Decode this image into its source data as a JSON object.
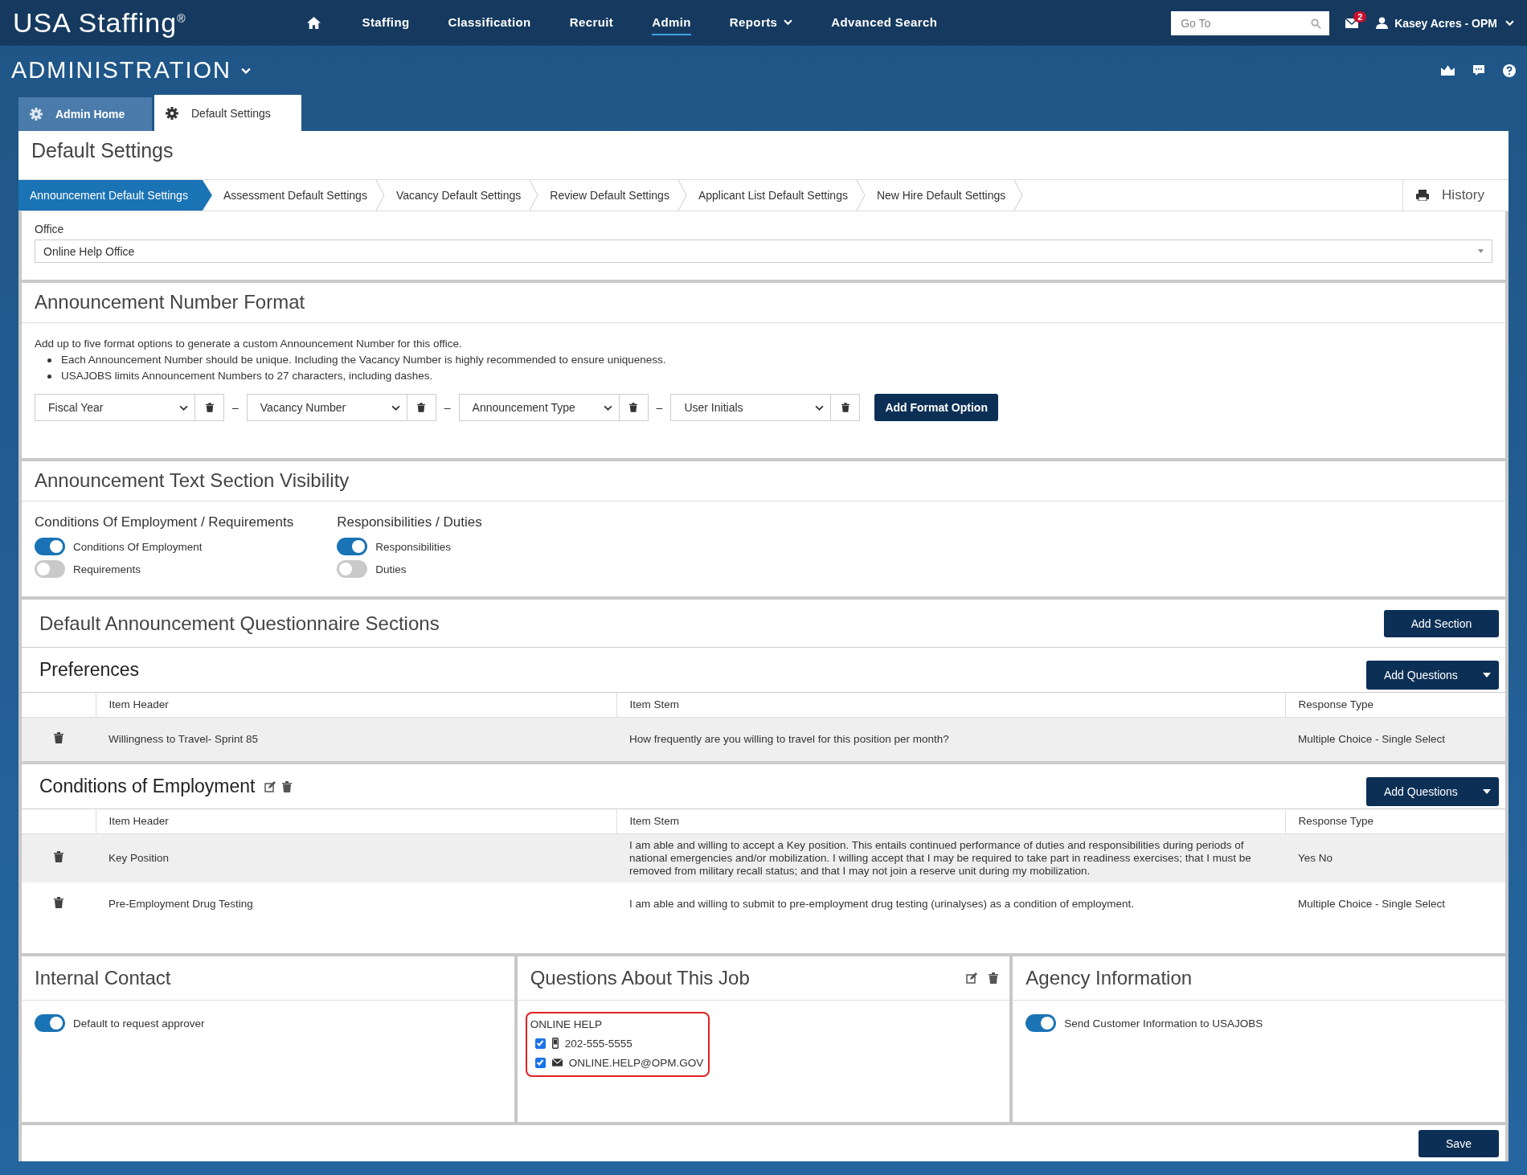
{
  "brand": {
    "name": "USA Staffing",
    "mark": "®"
  },
  "nav": [
    {
      "label": "Staffing",
      "selected": false,
      "dropdown": false
    },
    {
      "label": "Classification",
      "selected": false,
      "dropdown": false
    },
    {
      "label": "Recruit",
      "selected": false,
      "dropdown": false
    },
    {
      "label": "Admin",
      "selected": true,
      "dropdown": false
    },
    {
      "label": "Reports",
      "selected": false,
      "dropdown": true
    },
    {
      "label": "Advanced Search",
      "selected": false,
      "dropdown": false
    }
  ],
  "goto": {
    "placeholder": "Go To"
  },
  "mail_badge": "2",
  "user": "Kasey Acres - OPM",
  "app_title": "ADMINISTRATION",
  "page_tabs": [
    {
      "label": "Admin Home",
      "selected": false
    },
    {
      "label": "Default Settings",
      "selected": true
    }
  ],
  "page_title": "Default Settings",
  "steps": [
    {
      "label": "Announcement Default Settings",
      "selected": true
    },
    {
      "label": "Assessment Default Settings",
      "selected": false
    },
    {
      "label": "Vacancy Default Settings",
      "selected": false
    },
    {
      "label": "Review Default Settings",
      "selected": false
    },
    {
      "label": "Applicant List Default Settings",
      "selected": false
    },
    {
      "label": "New Hire Default Settings",
      "selected": false
    }
  ],
  "history": "History",
  "office": {
    "label": "Office",
    "value": "Online Help Office"
  },
  "number_format": {
    "title": "Announcement Number Format",
    "intro": "Add up to five format options to generate a custom Announcement Number for this office.",
    "bullets": [
      "Each Announcement Number should be unique. Including the Vacancy Number is highly recommended to ensure uniqueness.",
      "USAJOBS limits Announcement Numbers to 27 characters, including dashes."
    ],
    "options": [
      {
        "value": "Fiscal Year"
      },
      {
        "joiner": "–",
        "value": "Vacancy Number"
      },
      {
        "joiner": "–",
        "value": "Announcement Type"
      },
      {
        "joiner": "–",
        "value": "User Initials"
      }
    ],
    "add_button": "Add Format Option"
  },
  "visibility": {
    "title": "Announcement Text Section Visibility",
    "groups": [
      {
        "title": "Conditions Of Employment / Requirements",
        "toggles": [
          {
            "label": "Conditions Of Employment",
            "on": true
          },
          {
            "label": "Requirements",
            "on": false
          }
        ]
      },
      {
        "title": "Responsibilities / Duties",
        "toggles": [
          {
            "label": "Responsibilities",
            "on": true
          },
          {
            "label": "Duties",
            "on": false
          }
        ]
      }
    ]
  },
  "questionnaire": {
    "title": "Default Announcement Questionnaire Sections",
    "add_button": "Add Section",
    "sections": [
      {
        "title": "Preferences",
        "editable": false,
        "add_button": "Add Questions",
        "columns": [
          "Item Header",
          "Item Stem",
          "Response Type"
        ],
        "rows": [
          {
            "header": "Willingness to Travel- Sprint 85",
            "stem": "How frequently are you willing to travel for this position per month?",
            "response": "Multiple Choice - Single Select"
          }
        ]
      },
      {
        "title": "Conditions of Employment",
        "editable": true,
        "add_button": "Add Questions",
        "columns": [
          "Item Header",
          "Item Stem",
          "Response Type"
        ],
        "rows": [
          {
            "header": "Key Position",
            "stem": "I am able and willing to accept a Key position. This entails continued performance of duties and responsibilities during periods of national emergencies and/or mobilization. I willing accept that I may be required to take part in readiness exercises; that I must be removed from military recall status; and that I may not join a reserve unit during my mobilization.",
            "response": "Yes No"
          },
          {
            "header": "Pre-Employment Drug Testing",
            "stem": "I am able and willing to submit to pre-employment drug testing (urinalyses) as a condition of employment.",
            "response": "Multiple Choice - Single Select"
          }
        ]
      }
    ]
  },
  "panels": [
    {
      "kind": "toggles",
      "title": "Internal Contact",
      "toggles": [
        {
          "label": "Default to request approver",
          "on": true
        }
      ]
    },
    {
      "kind": "contact",
      "title": "Questions About This Job",
      "contact": {
        "name": "ONLINE HELP",
        "items": [
          {
            "kind": "phone",
            "text": "202-555-5555",
            "checked": true
          },
          {
            "kind": "email",
            "text": "ONLINE.HELP@OPM.GOV",
            "checked": true
          }
        ]
      }
    },
    {
      "kind": "toggles",
      "title": "Agency Information",
      "toggles": [
        {
          "label": "Send Customer Information to USAJOBS",
          "on": true
        }
      ]
    }
  ],
  "save": "Save"
}
